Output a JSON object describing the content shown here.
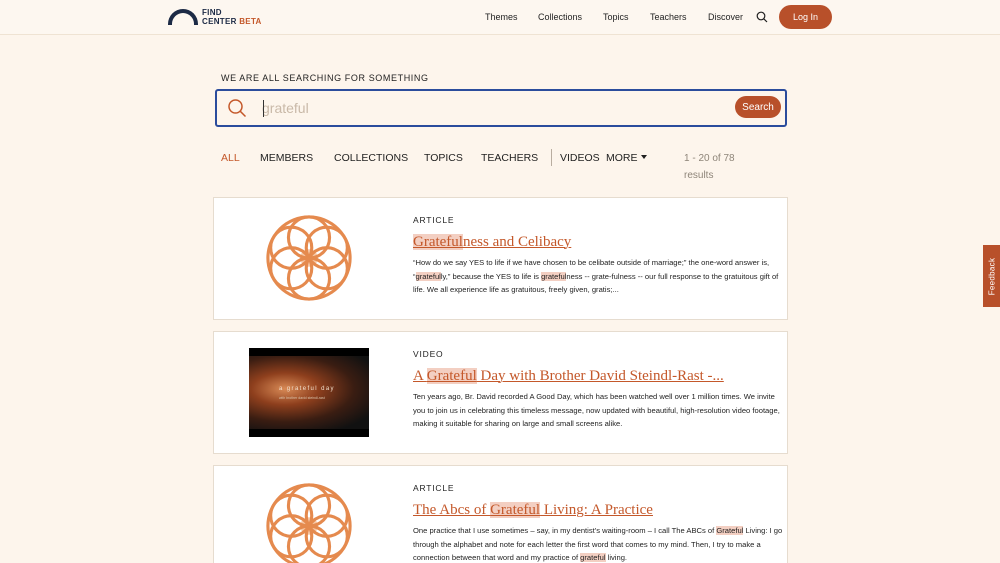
{
  "header": {
    "logo": {
      "line1": "FIND",
      "line2": "CENTER",
      "beta": "BETA"
    },
    "nav": [
      "Themes",
      "Collections",
      "Topics",
      "Teachers",
      "Discover"
    ],
    "login_label": "Log In"
  },
  "search": {
    "heading": "WE ARE ALL SEARCHING FOR SOMETHING",
    "placeholder": "grateful",
    "value": "",
    "button_label": "Search"
  },
  "filters": {
    "tabs": [
      "ALL",
      "MEMBERS",
      "COLLECTIONS",
      "TOPICS",
      "TEACHERS",
      "VIDEOS",
      "MORE"
    ],
    "active": "ALL",
    "results_text": "1 - 20 of 78 results"
  },
  "results": [
    {
      "type": "ARTICLE",
      "title_highlight": "Grateful",
      "title_rest": "ness and Celibacy",
      "excerpt": [
        {
          "t": "“How do we say YES to life if we have chosen to be celibate outside of marriage;” the one-word answer is, “"
        },
        {
          "h": "grateful"
        },
        {
          "t": "ly,” because the YES to life is "
        },
        {
          "h": "grateful"
        },
        {
          "t": "ness -- grate-fulness -- our full response to the gratuitous gift of life. We all experience life as gratuitous, freely given, gratis;..."
        }
      ],
      "thumb": "flower-of-life-icon"
    },
    {
      "type": "VIDEO",
      "title_before": "A ",
      "title_highlight": "Grateful",
      "title_rest": " Day with Brother David Steindl-Rast -...",
      "excerpt": [
        {
          "t": "Ten years ago, Br. David recorded A Good Day, which has been watched well over 1 million times. We invite you to join us in celebrating this timeless message, now updated with beautiful, high-resolution video footage, making it suitable for sharing on large and small screens alike."
        }
      ],
      "video_overlay": "a grateful day",
      "video_overlay_sub": "with brother david steindl-rast"
    },
    {
      "type": "ARTICLE",
      "title_before": "The Abcs of ",
      "title_highlight": "Grateful",
      "title_rest": " Living: A Practice",
      "excerpt": [
        {
          "t": "One practice that I use sometimes – say, in my dentist's waiting-room – I call The ABCs of "
        },
        {
          "h": "Grateful"
        },
        {
          "t": " Living: I go through the alphabet and note for each letter the first word that comes to my mind. Then, I try to make a connection between that word and my practice of "
        },
        {
          "h": "grateful"
        },
        {
          "t": " living."
        }
      ],
      "thumb": "flower-of-life-icon"
    }
  ],
  "feedback_label": "Feedback",
  "colors": {
    "accent": "#b8502a",
    "highlight": "#f3cfc2",
    "background": "#fdf5ec",
    "navy": "#1c2a45",
    "focus": "#2b4c9c"
  }
}
